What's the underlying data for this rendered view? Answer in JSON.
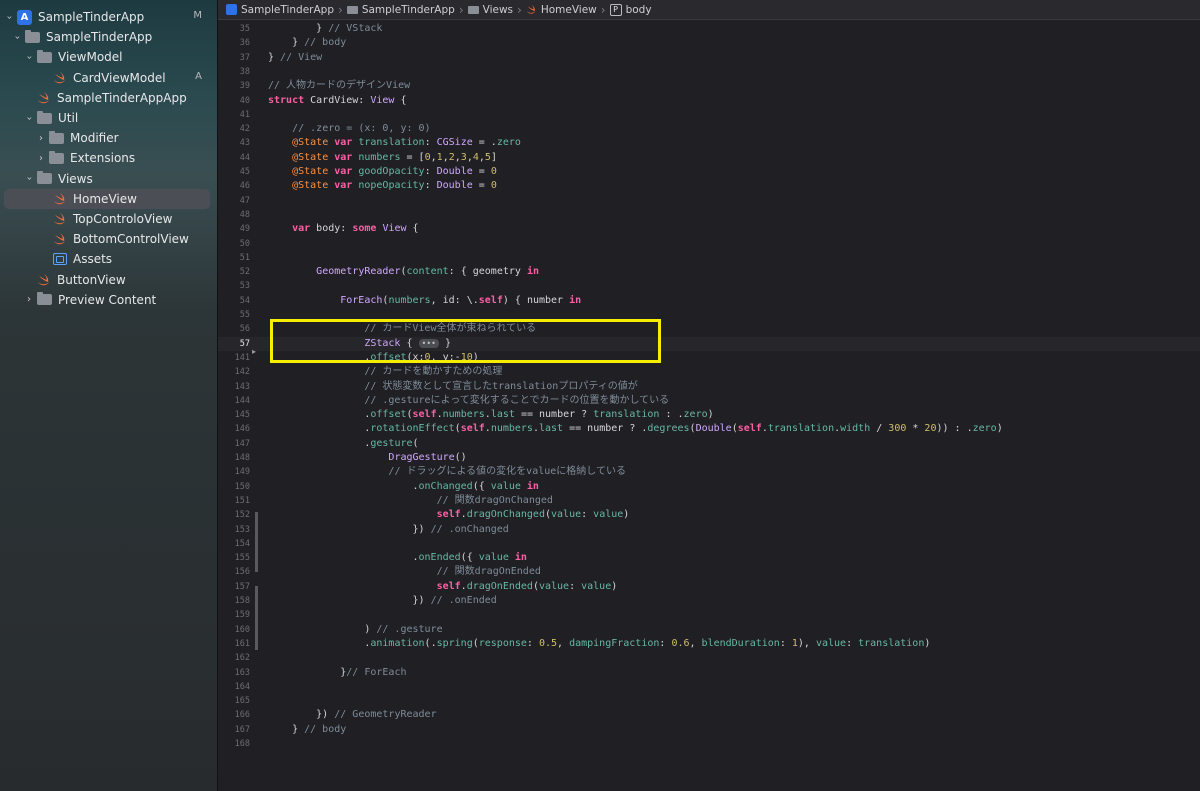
{
  "sidebar": {
    "items": [
      {
        "label": "SampleTinderApp",
        "badge": "M",
        "kind": "project",
        "expanded": true
      },
      {
        "label": "SampleTinderApp",
        "kind": "folder",
        "expanded": true
      },
      {
        "label": "ViewModel",
        "kind": "folder",
        "expanded": true
      },
      {
        "label": "CardViewModel",
        "badge": "A",
        "kind": "swift"
      },
      {
        "label": "SampleTinderAppApp",
        "kind": "swift"
      },
      {
        "label": "Util",
        "kind": "folder",
        "expanded": true
      },
      {
        "label": "Modifier",
        "kind": "folder",
        "expanded": false
      },
      {
        "label": "Extensions",
        "kind": "folder",
        "expanded": false
      },
      {
        "label": "Views",
        "kind": "folder",
        "expanded": true
      },
      {
        "label": "HomeView",
        "kind": "swift",
        "selected": true
      },
      {
        "label": "TopControloView",
        "kind": "swift"
      },
      {
        "label": "BottomControlView",
        "kind": "swift"
      },
      {
        "label": "Assets",
        "kind": "assets"
      },
      {
        "label": "ButtonView",
        "kind": "swift"
      },
      {
        "label": "Preview Content",
        "kind": "folder",
        "expanded": false
      }
    ]
  },
  "jumpbar": {
    "crumbs": [
      "SampleTinderApp",
      "SampleTinderApp",
      "Views",
      "HomeView",
      "body"
    ]
  },
  "editor": {
    "highlight_color": "#f6ee00",
    "lines": [
      {
        "n": "35",
        "t": "        } // VStack"
      },
      {
        "n": "36",
        "t": "    } // body"
      },
      {
        "n": "37",
        "t": "} // View"
      },
      {
        "n": "38",
        "t": ""
      },
      {
        "n": "39",
        "t": "// 人物カードのデザインView"
      },
      {
        "n": "40",
        "t": "struct CardView: View {"
      },
      {
        "n": "41",
        "t": ""
      },
      {
        "n": "42",
        "t": "    // .zero = (x: 0, y: 0)"
      },
      {
        "n": "43",
        "t": "    @State var translation: CGSize = .zero"
      },
      {
        "n": "44",
        "t": "    @State var numbers = [0,1,2,3,4,5]"
      },
      {
        "n": "45",
        "t": "    @State var goodOpacity: Double = 0"
      },
      {
        "n": "46",
        "t": "    @State var nopeOpacity: Double = 0"
      },
      {
        "n": "47",
        "t": ""
      },
      {
        "n": "48",
        "t": ""
      },
      {
        "n": "49",
        "t": "    var body: some View {"
      },
      {
        "n": "50",
        "t": ""
      },
      {
        "n": "51",
        "t": ""
      },
      {
        "n": "52",
        "t": "        GeometryReader(content: { geometry in"
      },
      {
        "n": "53",
        "t": ""
      },
      {
        "n": "54",
        "t": "            ForEach(numbers, id: \\.self) { number in"
      },
      {
        "n": "55",
        "t": ""
      },
      {
        "n": "56",
        "t": "                // カードView全体が束ねられている"
      },
      {
        "n": "57",
        "t": "                ZStack { ••• }"
      },
      {
        "n": "141",
        "t": "                .offset(x:0, y:-10)"
      },
      {
        "n": "142",
        "t": "                // カードを動かすための処理"
      },
      {
        "n": "143",
        "t": "                // 状態変数として宣言したtranslationプロパティの値が"
      },
      {
        "n": "144",
        "t": "                // .gestureによって変化することでカードの位置を動かしている"
      },
      {
        "n": "145",
        "t": "                .offset(self.numbers.last == number ? translation : .zero)"
      },
      {
        "n": "146",
        "t": "                .rotationEffect(self.numbers.last == number ? .degrees(Double(self.translation.width / 300 * 20)) : .zero)"
      },
      {
        "n": "147",
        "t": "                .gesture("
      },
      {
        "n": "148",
        "t": "                    DragGesture()"
      },
      {
        "n": "149",
        "t": "                    // ドラッグによる値の変化をvalueに格納している"
      },
      {
        "n": "150",
        "t": "                        .onChanged({ value in"
      },
      {
        "n": "151",
        "t": "                            // 関数dragOnChanged"
      },
      {
        "n": "152",
        "t": "                            self.dragOnChanged(value: value)"
      },
      {
        "n": "153",
        "t": "                        }) // .onChanged"
      },
      {
        "n": "154",
        "t": ""
      },
      {
        "n": "155",
        "t": "                        .onEnded({ value in"
      },
      {
        "n": "156",
        "t": "                            // 関数dragOnEnded"
      },
      {
        "n": "157",
        "t": "                            self.dragOnEnded(value: value)"
      },
      {
        "n": "158",
        "t": "                        }) // .onEnded"
      },
      {
        "n": "159",
        "t": ""
      },
      {
        "n": "160",
        "t": "                ) // .gesture"
      },
      {
        "n": "161",
        "t": "                .animation(.spring(response: 0.5, dampingFraction: 0.6, blendDuration: 1), value: translation)"
      },
      {
        "n": "162",
        "t": ""
      },
      {
        "n": "163",
        "t": "            }// ForEach"
      },
      {
        "n": "164",
        "t": ""
      },
      {
        "n": "165",
        "t": ""
      },
      {
        "n": "166",
        "t": "        }) // GeometryReader"
      },
      {
        "n": "167",
        "t": "    } // body"
      },
      {
        "n": "168",
        "t": ""
      }
    ]
  }
}
